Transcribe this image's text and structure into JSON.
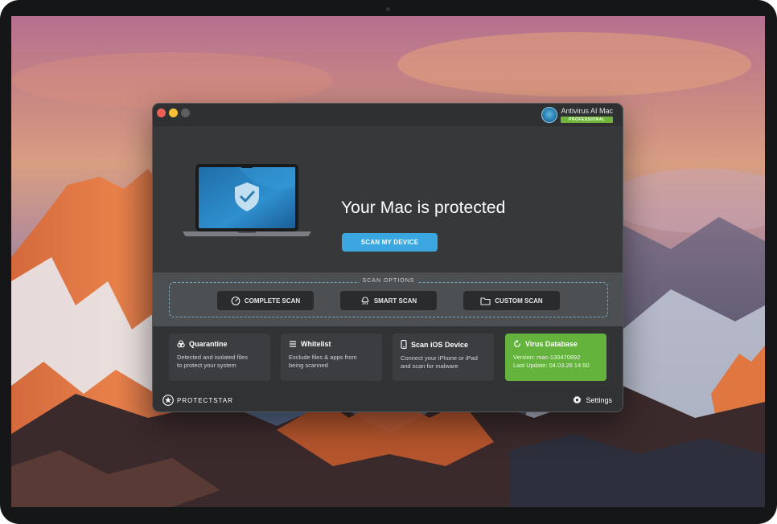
{
  "app": {
    "name": "Antivirus AI Mac",
    "edition_badge": "PROFESSIONAL"
  },
  "hero": {
    "status_title": "Your Mac is protected",
    "scan_button_label": "SCAN MY DEVICE"
  },
  "scan_options": {
    "section_label": "SCAN OPTIONS",
    "buttons": [
      {
        "label": "COMPLETE SCAN",
        "icon": "gauge-icon"
      },
      {
        "label": "SMART SCAN",
        "icon": "brain-icon"
      },
      {
        "label": "CUSTOM SCAN",
        "icon": "folder-icon"
      }
    ]
  },
  "cards": [
    {
      "title": "Quarantine",
      "icon": "biohazard-icon",
      "line1": "Detected and isolated files",
      "line2": "to protect your system"
    },
    {
      "title": "Whitelist",
      "icon": "list-icon",
      "line1": "Exclude files & apps from",
      "line2": "being scanned"
    },
    {
      "title": "Scan iOS Device",
      "icon": "phone-icon",
      "line1": "Connect your iPhone or iPad",
      "line2": "and scan for malware"
    },
    {
      "title": "Virus Database",
      "icon": "refresh-icon",
      "line1": "Version: mac-130470892",
      "line2": "Last Update: 04.03.26 14:50"
    }
  ],
  "footer": {
    "brand": "PROTECTSTAR",
    "settings_label": "Settings"
  },
  "colors": {
    "accent_blue": "#3aa7e0",
    "database_green": "#64b33c",
    "window_bg": "#3a3c3e"
  }
}
